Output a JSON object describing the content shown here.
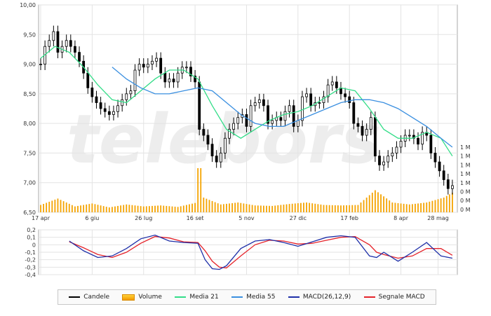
{
  "watermark": "telebors",
  "colors": {
    "candle": "#000000",
    "volume": "#f4a300",
    "ma21": "#33dd88",
    "ma55": "#3a8fe0",
    "macd": "#1e2fa8",
    "signal": "#e5232a",
    "grid": "#e3e3e3",
    "axis": "#aaaaaa"
  },
  "legend": [
    {
      "key": "candle",
      "label": "Candele",
      "icon": "line-swatch"
    },
    {
      "key": "volume",
      "label": "Volume",
      "icon": "bar-swatch"
    },
    {
      "key": "ma21",
      "label": "Media 21",
      "icon": "line-swatch"
    },
    {
      "key": "ma55",
      "label": "Media 55",
      "icon": "line-swatch"
    },
    {
      "key": "macd",
      "label": "MACD(26,12,9)",
      "icon": "line-swatch"
    },
    {
      "key": "signal",
      "label": "Segnale MACD",
      "icon": "line-swatch"
    }
  ],
  "chart_data": [
    {
      "type": "line",
      "subtype": "candlestick-with-volume",
      "y_ticks": [
        "10,00",
        "9,50",
        "9,00",
        "8,50",
        "8,00",
        "7,50",
        "7,00",
        "6,50"
      ],
      "ylim": [
        6.5,
        10.0
      ],
      "x_ticks": [
        "17 apr",
        "6 giu",
        "26 lug",
        "16 set",
        "5 nov",
        "27 dic",
        "17 feb",
        "8 apr",
        "28 mag"
      ],
      "volume_ticks": [
        "1 M",
        "1 M",
        "1 M",
        "1 M",
        "1 M",
        "0 M",
        "0 M",
        "0 M"
      ],
      "grid": true,
      "series": [
        {
          "name": "Candele",
          "type": "candlestick",
          "x": [
            0,
            3,
            6,
            9,
            12,
            15,
            18,
            21,
            24,
            27,
            30,
            33,
            36,
            39,
            42,
            45,
            48,
            51,
            54,
            57,
            60,
            63,
            66,
            69,
            72,
            75,
            78,
            81,
            84,
            87,
            90,
            93,
            96,
            99,
            102,
            105,
            108,
            111,
            114,
            117,
            120,
            123,
            126,
            129,
            132,
            135,
            138,
            141,
            144,
            147,
            150,
            153,
            156,
            159,
            162,
            165,
            168,
            171,
            174,
            177,
            180,
            183,
            186,
            189,
            192,
            195,
            198,
            201,
            204,
            207,
            210,
            213,
            216,
            219,
            222,
            225,
            228,
            231,
            234,
            237,
            240,
            243,
            246,
            249,
            252,
            255,
            258,
            261,
            264,
            267,
            270,
            273,
            276,
            279,
            282,
            285,
            288
          ],
          "y": [
            9.0,
            9.3,
            9.4,
            9.55,
            9.2,
            9.3,
            9.4,
            9.3,
            9.2,
            9.05,
            8.85,
            8.6,
            8.45,
            8.35,
            8.25,
            8.2,
            8.15,
            8.2,
            8.3,
            8.4,
            8.5,
            8.55,
            8.9,
            9.0,
            8.95,
            9.0,
            9.05,
            9.1,
            8.85,
            8.7,
            8.75,
            8.7,
            8.85,
            8.95,
            8.95,
            8.8,
            8.7,
            7.9,
            7.8,
            7.65,
            7.45,
            7.35,
            7.5,
            7.75,
            7.9,
            8.0,
            8.1,
            8.15,
            7.95,
            8.3,
            8.35,
            8.4,
            8.3,
            8.0,
            8.05,
            8.1,
            8.05,
            8.2,
            8.3,
            7.95,
            8.05,
            8.45,
            8.5,
            8.3,
            8.35,
            8.35,
            8.45,
            8.65,
            8.7,
            8.6,
            8.5,
            8.45,
            8.35,
            8.0,
            7.95,
            7.8,
            7.9,
            8.1,
            7.45,
            7.3,
            7.35,
            7.45,
            7.5,
            7.6,
            7.7,
            7.8,
            7.8,
            7.75,
            7.65,
            7.85,
            7.8,
            7.5,
            7.35,
            7.2,
            7.05,
            6.9,
            6.95
          ]
        },
        {
          "name": "Media 21",
          "type": "line",
          "x": [
            0,
            10,
            20,
            30,
            40,
            50,
            60,
            70,
            80,
            90,
            100,
            110,
            120,
            130,
            140,
            150,
            160,
            170,
            180,
            190,
            200,
            210,
            220,
            230,
            240,
            250,
            260,
            270,
            280,
            288
          ],
          "y": [
            9.1,
            9.3,
            9.2,
            8.95,
            8.65,
            8.4,
            8.35,
            8.55,
            8.75,
            8.9,
            8.9,
            8.75,
            8.3,
            7.9,
            7.75,
            7.9,
            8.05,
            8.15,
            8.2,
            8.3,
            8.45,
            8.6,
            8.55,
            8.25,
            7.9,
            7.75,
            7.75,
            7.85,
            7.75,
            7.45
          ]
        },
        {
          "name": "Media 55",
          "type": "line",
          "x": [
            50,
            60,
            70,
            80,
            90,
            100,
            110,
            120,
            130,
            140,
            150,
            160,
            170,
            180,
            190,
            200,
            210,
            220,
            230,
            240,
            250,
            260,
            270,
            280,
            288
          ],
          "y": [
            8.95,
            8.75,
            8.6,
            8.5,
            8.5,
            8.55,
            8.6,
            8.55,
            8.35,
            8.15,
            8.0,
            7.95,
            7.95,
            8.05,
            8.15,
            8.25,
            8.35,
            8.4,
            8.4,
            8.35,
            8.25,
            8.1,
            7.95,
            7.75,
            7.6
          ]
        }
      ],
      "volume": [
        {
          "x": 0,
          "v": 0.15
        },
        {
          "x": 12,
          "v": 0.28
        },
        {
          "x": 24,
          "v": 0.12
        },
        {
          "x": 36,
          "v": 0.18
        },
        {
          "x": 48,
          "v": 0.1
        },
        {
          "x": 60,
          "v": 0.16
        },
        {
          "x": 72,
          "v": 0.12
        },
        {
          "x": 84,
          "v": 0.14
        },
        {
          "x": 96,
          "v": 0.11
        },
        {
          "x": 108,
          "v": 0.19
        },
        {
          "x": 111,
          "v": 0.9
        },
        {
          "x": 114,
          "v": 0.3
        },
        {
          "x": 126,
          "v": 0.16
        },
        {
          "x": 138,
          "v": 0.2
        },
        {
          "x": 150,
          "v": 0.14
        },
        {
          "x": 162,
          "v": 0.13
        },
        {
          "x": 174,
          "v": 0.17
        },
        {
          "x": 186,
          "v": 0.2
        },
        {
          "x": 198,
          "v": 0.15
        },
        {
          "x": 210,
          "v": 0.14
        },
        {
          "x": 222,
          "v": 0.15
        },
        {
          "x": 234,
          "v": 0.45
        },
        {
          "x": 246,
          "v": 0.2
        },
        {
          "x": 258,
          "v": 0.16
        },
        {
          "x": 270,
          "v": 0.2
        },
        {
          "x": 282,
          "v": 0.3
        },
        {
          "x": 288,
          "v": 0.4
        }
      ]
    },
    {
      "type": "line",
      "y_ticks": [
        "0,2",
        "0,1",
        "0",
        "-0,1",
        "-0,2",
        "-0,3",
        "-0,4"
      ],
      "ylim": [
        -0.4,
        0.2
      ],
      "grid": true,
      "series": [
        {
          "name": "MACD(26,12,9)",
          "x": [
            20,
            30,
            40,
            50,
            60,
            70,
            80,
            90,
            100,
            110,
            115,
            120,
            125,
            130,
            140,
            150,
            160,
            170,
            180,
            190,
            200,
            210,
            220,
            230,
            235,
            240,
            250,
            260,
            270,
            280,
            288
          ],
          "y": [
            0.05,
            -0.08,
            -0.17,
            -0.15,
            -0.05,
            0.08,
            0.13,
            0.05,
            0.03,
            0.02,
            -0.2,
            -0.32,
            -0.33,
            -0.28,
            -0.05,
            0.05,
            0.07,
            0.03,
            -0.02,
            0.04,
            0.1,
            0.12,
            0.1,
            -0.15,
            -0.17,
            -0.1,
            -0.22,
            -0.1,
            0.03,
            -0.15,
            -0.18
          ]
        },
        {
          "name": "Segnale MACD",
          "x": [
            20,
            30,
            40,
            50,
            60,
            70,
            80,
            90,
            100,
            110,
            115,
            120,
            125,
            130,
            140,
            150,
            160,
            170,
            180,
            190,
            200,
            210,
            220,
            230,
            235,
            240,
            250,
            260,
            270,
            280,
            288
          ],
          "y": [
            0.04,
            -0.04,
            -0.13,
            -0.17,
            -0.1,
            0.02,
            0.11,
            0.09,
            0.04,
            0.03,
            -0.08,
            -0.22,
            -0.3,
            -0.31,
            -0.15,
            0.0,
            0.06,
            0.05,
            0.01,
            0.02,
            0.06,
            0.1,
            0.11,
            0.0,
            -0.1,
            -0.13,
            -0.18,
            -0.15,
            -0.05,
            -0.05,
            -0.14
          ]
        }
      ]
    }
  ]
}
